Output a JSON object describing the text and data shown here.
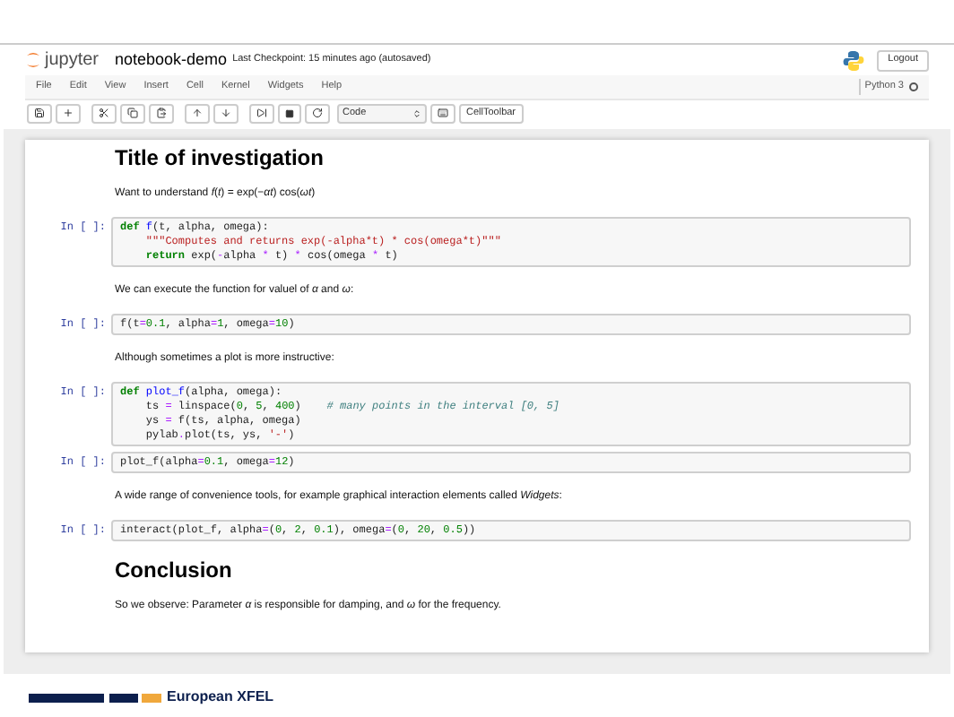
{
  "header": {
    "logo_text": "jupyter",
    "notebook_name": "notebook-demo",
    "checkpoint": "Last Checkpoint: 15 minutes ago (autosaved)",
    "logout": "Logout"
  },
  "menu": [
    "File",
    "Edit",
    "View",
    "Insert",
    "Cell",
    "Kernel",
    "Widgets",
    "Help"
  ],
  "kernel": {
    "name": "Python 3",
    "busy": false
  },
  "toolbar": {
    "cell_type": "Code",
    "cell_toolbar": "CellToolbar"
  },
  "cells": [
    {
      "kind": "heading",
      "text": "Title of investigation"
    },
    {
      "kind": "markdown",
      "text": "Want to understand *f*(*t*) = exp(−*αt*) cos(*ωt*)"
    },
    {
      "kind": "code",
      "prompt": "In [ ]:",
      "lines": [
        [
          {
            "kind": "kw",
            "text": "def"
          },
          {
            "kind": "name",
            "text": " f"
          },
          {
            "kind": "plain",
            "text": "(t, alpha, omega):"
          }
        ],
        [
          {
            "kind": "str",
            "text": "    \"\"\"Computes and returns exp(-alpha*t) * cos(omega*t)\"\"\""
          }
        ],
        [
          {
            "kind": "kw",
            "text": "    return"
          },
          {
            "kind": "plain",
            "text": " exp("
          },
          {
            "kind": "op",
            "text": "-"
          },
          {
            "kind": "plain",
            "text": "alpha "
          },
          {
            "kind": "op",
            "text": "*"
          },
          {
            "kind": "plain",
            "text": " t) "
          },
          {
            "kind": "op",
            "text": "*"
          },
          {
            "kind": "plain",
            "text": " cos(omega "
          },
          {
            "kind": "op",
            "text": "*"
          },
          {
            "kind": "plain",
            "text": " t)"
          }
        ]
      ]
    },
    {
      "kind": "markdown",
      "text": "We can execute the function for valuel of *α* and *ω*:"
    },
    {
      "kind": "code",
      "prompt": "In [ ]:",
      "lines": [
        [
          {
            "kind": "plain",
            "text": "f(t"
          },
          {
            "kind": "op",
            "text": "="
          },
          {
            "kind": "num",
            "text": "0.1"
          },
          {
            "kind": "plain",
            "text": ", alpha"
          },
          {
            "kind": "op",
            "text": "="
          },
          {
            "kind": "num",
            "text": "1"
          },
          {
            "kind": "plain",
            "text": ", omega"
          },
          {
            "kind": "op",
            "text": "="
          },
          {
            "kind": "num",
            "text": "10"
          },
          {
            "kind": "plain",
            "text": ")"
          }
        ]
      ]
    },
    {
      "kind": "markdown",
      "text": "Although sometimes a plot is more instructive:"
    },
    {
      "kind": "code",
      "prompt": "In [ ]:",
      "lines": [
        [
          {
            "kind": "kw",
            "text": "def"
          },
          {
            "kind": "name",
            "text": " plot_f"
          },
          {
            "kind": "plain",
            "text": "(alpha, omega):"
          }
        ],
        [
          {
            "kind": "plain",
            "text": "    ts "
          },
          {
            "kind": "op",
            "text": "="
          },
          {
            "kind": "plain",
            "text": " linspace("
          },
          {
            "kind": "num",
            "text": "0"
          },
          {
            "kind": "plain",
            "text": ", "
          },
          {
            "kind": "num",
            "text": "5"
          },
          {
            "kind": "plain",
            "text": ", "
          },
          {
            "kind": "num",
            "text": "400"
          },
          {
            "kind": "plain",
            "text": ")    "
          },
          {
            "kind": "comment",
            "text": "# many points in the interval [0, 5]"
          }
        ],
        [
          {
            "kind": "plain",
            "text": "    ys "
          },
          {
            "kind": "op",
            "text": "="
          },
          {
            "kind": "plain",
            "text": " f(ts, alpha, omega)"
          }
        ],
        [
          {
            "kind": "plain",
            "text": "    pylab"
          },
          {
            "kind": "op",
            "text": "."
          },
          {
            "kind": "plain",
            "text": "plot(ts, ys, "
          },
          {
            "kind": "str",
            "text": "'-'"
          },
          {
            "kind": "plain",
            "text": ")"
          }
        ]
      ]
    },
    {
      "kind": "code",
      "prompt": "In [ ]:",
      "lines": [
        [
          {
            "kind": "plain",
            "text": "plot_f(alpha"
          },
          {
            "kind": "op",
            "text": "="
          },
          {
            "kind": "num",
            "text": "0.1"
          },
          {
            "kind": "plain",
            "text": ", omega"
          },
          {
            "kind": "op",
            "text": "="
          },
          {
            "kind": "num",
            "text": "12"
          },
          {
            "kind": "plain",
            "text": ")"
          }
        ]
      ]
    },
    {
      "kind": "markdown",
      "text": "A wide range of convenience tools, for example graphical interaction elements called *Widgets*:"
    },
    {
      "kind": "code",
      "prompt": "In [ ]:",
      "lines": [
        [
          {
            "kind": "plain",
            "text": "interact(plot_f, alpha"
          },
          {
            "kind": "op",
            "text": "="
          },
          {
            "kind": "plain",
            "text": "("
          },
          {
            "kind": "num",
            "text": "0"
          },
          {
            "kind": "plain",
            "text": ", "
          },
          {
            "kind": "num",
            "text": "2"
          },
          {
            "kind": "plain",
            "text": ", "
          },
          {
            "kind": "num",
            "text": "0.1"
          },
          {
            "kind": "plain",
            "text": "), omega"
          },
          {
            "kind": "op",
            "text": "="
          },
          {
            "kind": "plain",
            "text": "("
          },
          {
            "kind": "num",
            "text": "0"
          },
          {
            "kind": "plain",
            "text": ", "
          },
          {
            "kind": "num",
            "text": "20"
          },
          {
            "kind": "plain",
            "text": ", "
          },
          {
            "kind": "num",
            "text": "0.5"
          },
          {
            "kind": "plain",
            "text": "))"
          }
        ]
      ]
    },
    {
      "kind": "heading",
      "text": "Conclusion"
    },
    {
      "kind": "markdown",
      "text": "So we observe: Parameter *α* is responsible for damping, and *ω* for the frequency."
    }
  ],
  "footer": {
    "brand": "European XFEL"
  }
}
